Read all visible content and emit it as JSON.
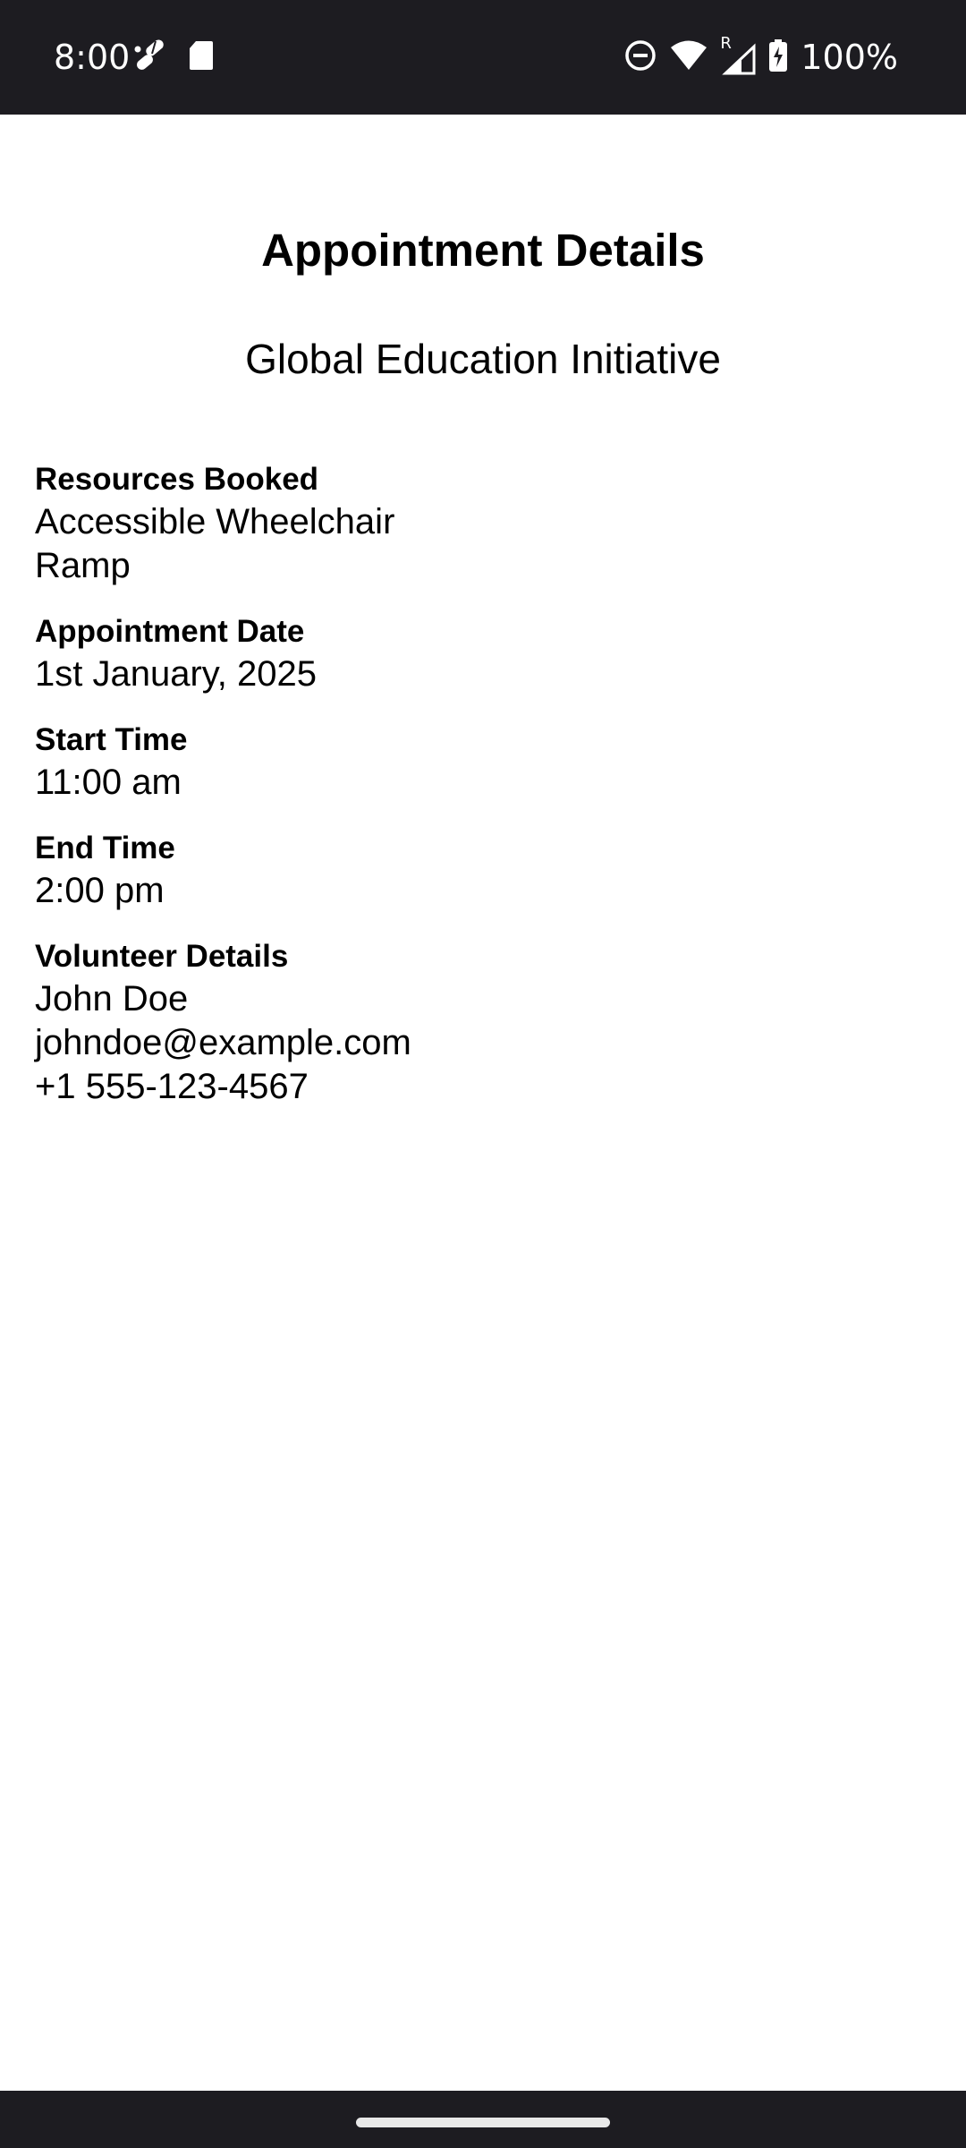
{
  "status_bar": {
    "time": "8:00",
    "battery": "100%",
    "icons": [
      "pill-notification-icon",
      "sd-card-icon",
      "do-not-disturb-icon",
      "wifi-icon",
      "cellular-roaming-icon",
      "battery-charging-icon"
    ],
    "roaming_indicator": "R"
  },
  "page": {
    "title": "Appointment Details",
    "organization": "Global Education Initiative"
  },
  "fields": {
    "resources": {
      "label": "Resources Booked",
      "value": "Accessible Wheelchair Ramp"
    },
    "date": {
      "label": "Appointment Date",
      "value": "1st January, 2025"
    },
    "start": {
      "label": "Start Time",
      "value": "11:00 am"
    },
    "end": {
      "label": "End Time",
      "value": "2:00 pm"
    },
    "volunteer": {
      "label": "Volunteer Details",
      "name": "John Doe",
      "email": "johndoe@example.com",
      "phone": "+1 555-123-4567"
    }
  },
  "colors": {
    "system_bar": "#1d1c21",
    "background": "#ffffff",
    "text": "#000000"
  }
}
